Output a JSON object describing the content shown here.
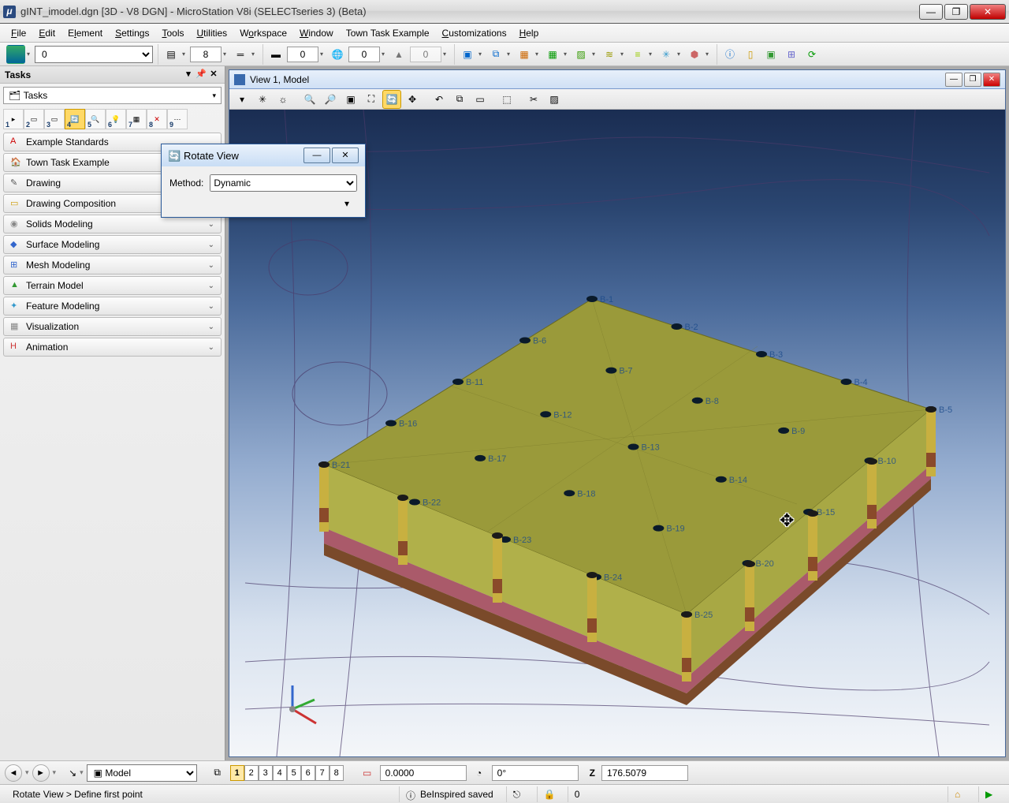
{
  "window": {
    "title": "gINT_imodel.dgn [3D - V8 DGN] - MicroStation V8i (SELECTseries 3) (Beta)"
  },
  "menu": {
    "items": [
      "File",
      "Edit",
      "Element",
      "Settings",
      "Tools",
      "Utilities",
      "Workspace",
      "Window",
      "Town Task Example",
      "Customizations",
      "Help"
    ]
  },
  "toolbar": {
    "level_value": "0",
    "weight_value": "8",
    "count2": "0",
    "count3": "0",
    "count4": "0"
  },
  "tasks": {
    "header": "Tasks",
    "combo": "Tasks",
    "iconrow_nums": [
      "1",
      "2",
      "3",
      "4",
      "5",
      "6",
      "7",
      "8",
      "9"
    ],
    "categories": [
      {
        "label": "Example Standards",
        "icon": "A",
        "color": "#c00"
      },
      {
        "label": "Town Task Example",
        "icon": "🏠",
        "color": "#c00"
      },
      {
        "label": "Drawing",
        "icon": "✎",
        "color": "#555"
      },
      {
        "label": "Drawing Composition",
        "icon": "▭",
        "color": "#c90"
      },
      {
        "label": "Solids Modeling",
        "icon": "◉",
        "color": "#888",
        "exp": true
      },
      {
        "label": "Surface Modeling",
        "icon": "◆",
        "color": "#36c",
        "exp": true
      },
      {
        "label": "Mesh Modeling",
        "icon": "⊞",
        "color": "#36c",
        "exp": true
      },
      {
        "label": "Terrain Model",
        "icon": "▲",
        "color": "#393",
        "exp": true
      },
      {
        "label": "Feature Modeling",
        "icon": "✦",
        "color": "#39c",
        "exp": true
      },
      {
        "label": "Visualization",
        "icon": "▦",
        "color": "#888",
        "exp": true
      },
      {
        "label": "Animation",
        "icon": "H",
        "color": "#c33",
        "exp": true
      }
    ]
  },
  "viewport": {
    "title": "View 1, Model",
    "borehole_labels": [
      "B-1",
      "B-2",
      "B-3",
      "B-4",
      "B-5",
      "B-6",
      "B-7",
      "B-8",
      "B-9",
      "B-10",
      "B-11",
      "B-12",
      "B-13",
      "B-14",
      "B-15",
      "B-16",
      "B-17",
      "B-18",
      "B-19",
      "B-20",
      "B-21",
      "B-22",
      "B-23",
      "B-24",
      "B-25"
    ]
  },
  "rotate_dialog": {
    "title": "Rotate View",
    "method_label": "Method:",
    "method_value": "Dynamic"
  },
  "bottom": {
    "model_combo": "Model",
    "view_buttons": [
      "1",
      "2",
      "3",
      "4",
      "5",
      "6",
      "7",
      "8"
    ],
    "active_view": "1",
    "coord_x": "0.0000",
    "angle": "0°",
    "z_label": "Z",
    "z_value": "176.5079"
  },
  "status": {
    "prompt": "Rotate View > Define first point",
    "message": "BeInspired saved",
    "lock_value": "0"
  }
}
